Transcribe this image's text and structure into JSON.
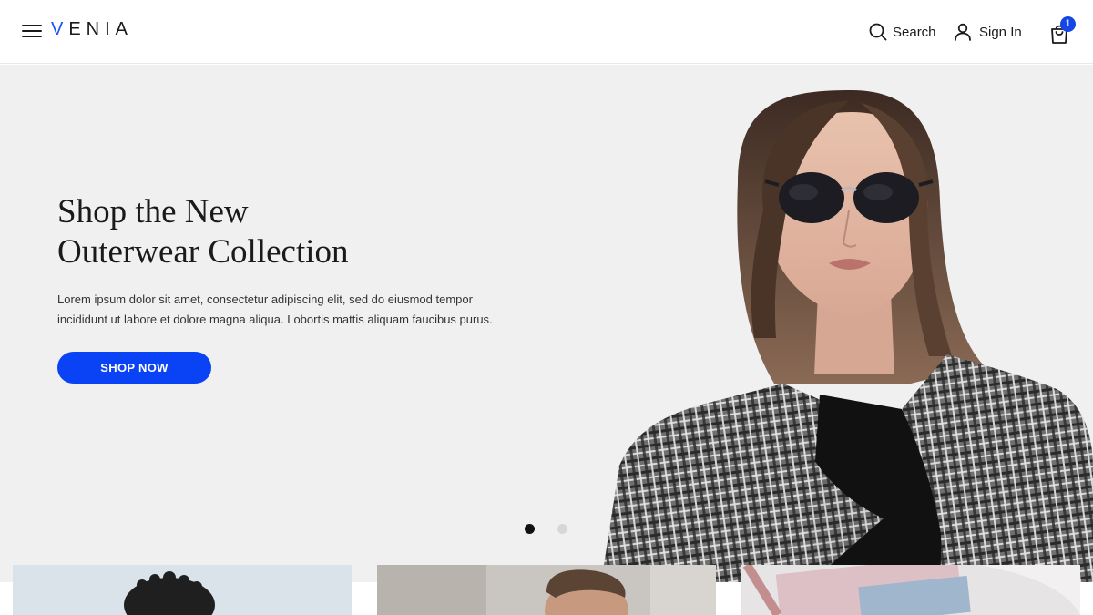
{
  "header": {
    "logo_prefix": "V",
    "logo_rest": "ENIA",
    "search_label": "Search",
    "signin_label": "Sign In",
    "cart_count": "1"
  },
  "hero": {
    "title_line1": "Shop the New",
    "title_line2": "Outerwear Collection",
    "body": "Lorem ipsum dolor sit amet, consectetur adipiscing elit, sed do eiusmod tempor incididunt ut labore et dolore magna aliqua. Lobortis mattis aliquam faucibus purus.",
    "cta_label": "SHOP NOW",
    "carousel_active_index": 0,
    "carousel_slides": 2
  },
  "icons": {
    "menu": "menu-icon",
    "search": "search-icon",
    "user": "user-icon",
    "cart": "shopping-bag-icon"
  },
  "colors": {
    "accent": "#0a42f5",
    "hero_bg": "#f0f0f0",
    "badge": "#1447e6"
  }
}
